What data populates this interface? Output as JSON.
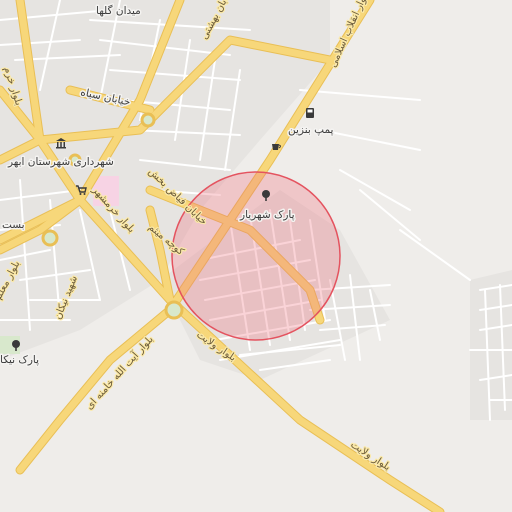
{
  "map": {
    "colors": {
      "background": "#efedea",
      "block": "#e3e1de",
      "major_road": "#f7d77a",
      "major_road_casing": "#e9bf55",
      "minor_road": "#ffffff",
      "minor_road_casing": "#d7d5d2",
      "park": "#d8e8cc",
      "hospital": "#f7d3e4",
      "radius_fill": "#f06d7a",
      "radius_stroke": "#e4535f"
    },
    "highlight_circle": {
      "shape": "circle",
      "fill_opacity": 0.3
    },
    "labels": {
      "maydan_golha": "میدان گلها",
      "blvd_enqelab": "بلوار انقلاب اسلامی",
      "khiaban_sayyah": "خیابان سیاه",
      "pomp_benzin": "پمپ بنزین",
      "shahrdari": "شهرداری شهرستان ابهر",
      "park_shahriar": "پارک شهریار",
      "khiaban_fayyaz": "خیابان فیاض بخش",
      "kuche_meysam": "کوچه میثم",
      "blvd_khorramshahr": "بلوار خرمشهر",
      "blvd_velayat_1": "بلوار ولایت",
      "blvd_velayat_2": "بلوار ولایت",
      "blvd_khamenei": "بلوار آیت الله خامنه ای",
      "park_nikan": "پارک نیکا",
      "blvd_moallem": "بلوار معلم",
      "shahid_nikan": "شهید نیکان",
      "bast": "بست",
      "blvd_shahidan": "بلوار شهید",
      "blvd_left": "بلوار خرم",
      "khiaban_bahesti": "خیابان بهشتی"
    },
    "pois": [
      {
        "name": "gas-station",
        "icon": "fuel-pump-icon"
      },
      {
        "name": "cafe",
        "icon": "coffee-cup-icon"
      },
      {
        "name": "town-hall",
        "icon": "government-building-icon"
      },
      {
        "name": "park",
        "icon": "tree-icon"
      },
      {
        "name": "shop",
        "icon": "shopping-cart-icon"
      },
      {
        "name": "park-nikan",
        "icon": "tree-icon"
      }
    ]
  }
}
